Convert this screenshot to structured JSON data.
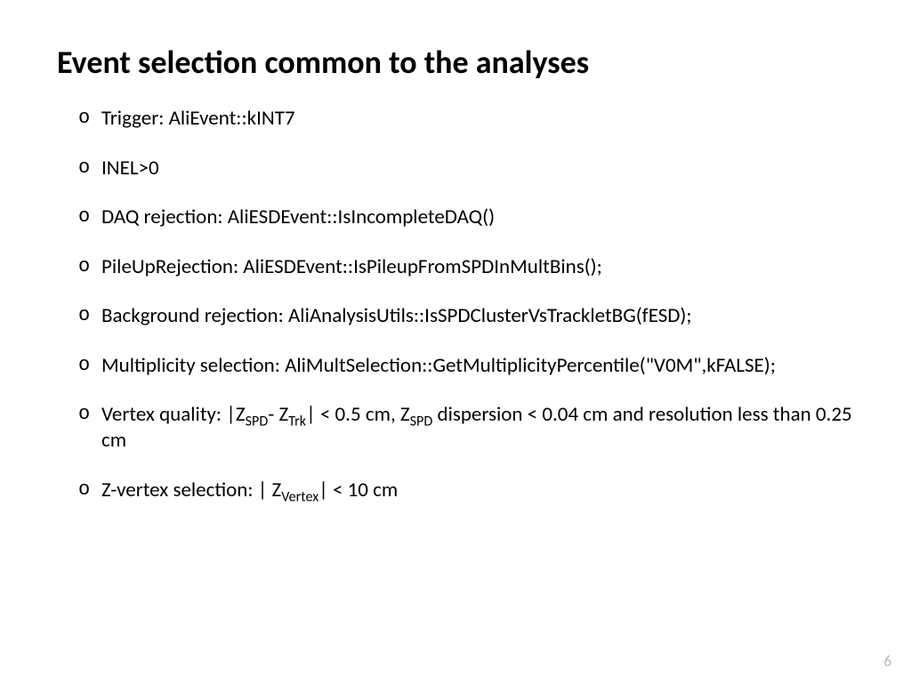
{
  "slide": {
    "title": "Event selection common to the analyses",
    "bullets": [
      {
        "text": "Trigger: AliEvent::kINT7"
      },
      {
        "text": "INEL>0"
      },
      {
        "text": "DAQ rejection: AliESDEvent::IsIncompleteDAQ()"
      },
      {
        "text": "PileUpRejection: AliESDEvent::IsPileupFromSPDInMultBins();"
      },
      {
        "text": "Background rejection: AliAnalysisUtils::IsSPDClusterVsTrackletBG(fESD);"
      },
      {
        "text": "Multiplicity selection: AliMultSelection::GetMultiplicityPercentile(\"V0M\",kFALSE);"
      },
      {
        "html": "Vertex quality: |Z<span class=\"sub\">SPD</span>- Z<span class=\"sub\">Trk</span>| < 0.5 cm, Z<span class=\"sub\">SPD</span> dispersion < 0.04 cm and resolution less than 0.25 cm"
      },
      {
        "html": "Z-vertex selection: | Z<span class=\"sub\">Vertex</span>| < 10 cm"
      }
    ],
    "page_number": "6"
  }
}
